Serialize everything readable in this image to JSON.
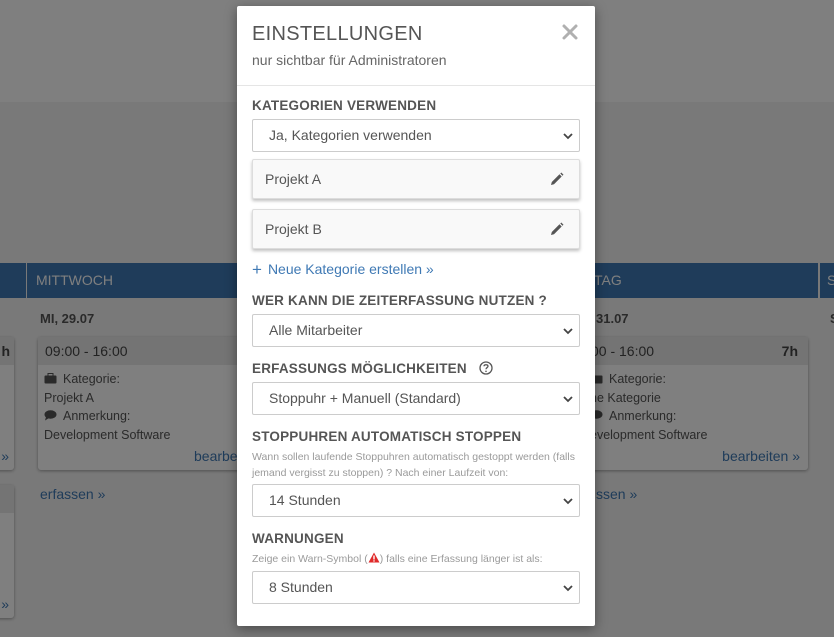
{
  "background": {
    "columns": [
      {
        "day": "",
        "date": "",
        "time": "",
        "hours": "h",
        "show_category": false,
        "category_label": "",
        "category_value": "",
        "note_label": "",
        "note_value": "",
        "edit": "»",
        "erfassen": ""
      },
      {
        "day": "MITTWOCH",
        "date": "MI, 29.07",
        "time": "09:00 - 16:00",
        "hours": "",
        "show_category": true,
        "category_label": "Kategorie:",
        "category_value": "Projekt A",
        "note_label": "Anmerkung:",
        "note_value": "Development Software",
        "edit": "bearbe",
        "erfassen": "erfassen »"
      },
      {
        "day": "TAG",
        "date": "31.07",
        "time": "00 - 16:00",
        "hours": "7h",
        "show_category": true,
        "category_label": "Kategorie:",
        "category_value": "ne Kategorie",
        "note_label": "Anmerkung:",
        "note_value": "evelopment Software",
        "edit": "bearbeiten »",
        "erfassen": "ssen »"
      },
      {
        "day": "S",
        "date": "S",
        "time": "",
        "hours": "",
        "show_category": false
      }
    ],
    "left_stub2_edit": "»"
  },
  "modal": {
    "title": "EINSTELLUNGEN",
    "subtitle": "nur sichtbar für Administratoren",
    "close_icon": "close-icon",
    "kategorien": {
      "heading": "KATEGORIEN VERWENDEN",
      "select_value": "Ja, Kategorien verwenden",
      "items": [
        {
          "name": "Projekt A",
          "icon": "pencil-icon"
        },
        {
          "name": "Projekt B",
          "icon": "pencil-icon"
        }
      ],
      "new_link": "Neue Kategorie erstellen »"
    },
    "wer": {
      "heading": "WER KANN DIE ZEITERFASSUNG NUTZEN ?",
      "select_value": "Alle Mitarbeiter"
    },
    "erfassung": {
      "heading": "ERFASSUNGS MÖGLICHKEITEN",
      "help_icon": "question-circle-icon",
      "select_value": "Stoppuhr + Manuell (Standard)"
    },
    "stoppuhren": {
      "heading": "STOPPUHREN AUTOMATISCH STOPPEN",
      "help": "Wann sollen laufende Stoppuhren automatisch gestoppt werden (falls jemand vergisst zu stoppen) ? Nach einer Laufzeit von:",
      "select_value": "14 Stunden"
    },
    "warnungen": {
      "heading": "WARNUNGEN",
      "help_before": "Zeige ein Warn-Symbol (",
      "help_after": ") falls eine Erfassung länger ist als:",
      "warn_color": "#e02b2b",
      "select_value": "8 Stunden"
    }
  },
  "colors": {
    "accent": "#3f79b4",
    "text": "#555555"
  }
}
